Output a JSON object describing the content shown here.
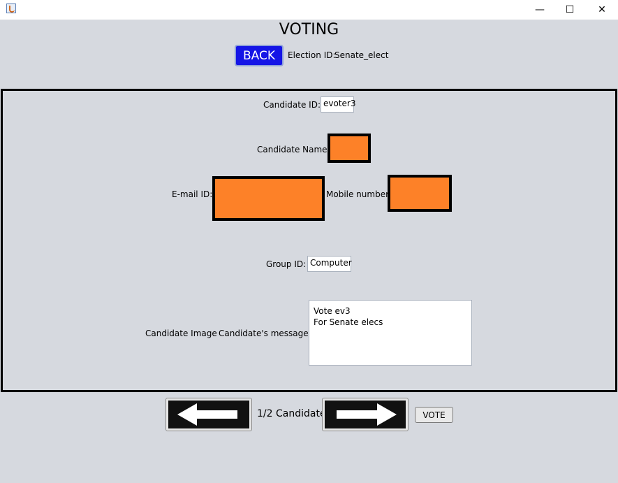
{
  "window": {
    "minimize_glyph": "—",
    "maximize_glyph": "☐",
    "close_glyph": "✕"
  },
  "header": {
    "title": "VOTING",
    "back_label": "BACK",
    "election_label": "Election ID:",
    "election_value": "Senate_elect"
  },
  "form": {
    "candidate_id_label": "Candidate ID:",
    "candidate_id_value": "evoter3",
    "candidate_name_label": "Candidate Name:",
    "email_label": "E-mail ID:",
    "mobile_label": "Mobile number:",
    "group_id_label": "Group ID:",
    "group_id_value": "Computer",
    "image_label": "Candidate Image",
    "message_label": "Candidate's message",
    "message_lines": [
      "Vote ev3",
      "For Senate elecs"
    ]
  },
  "footer": {
    "candidate_counter": "1/2 Candidate",
    "vote_label": "VOTE"
  },
  "colors": {
    "accent_blue": "#1515e6",
    "redacted_orange": "#fd8128"
  }
}
